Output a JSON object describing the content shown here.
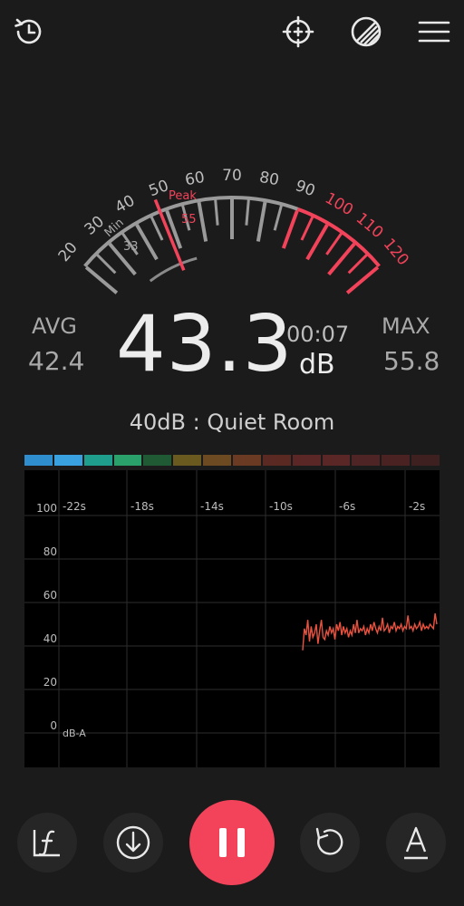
{
  "toolbar": {
    "history_icon": "history-icon",
    "calibrate_icon": "crosshair-icon",
    "theme_icon": "theme-icon",
    "menu_icon": "menu-icon"
  },
  "gauge": {
    "scale_labels": [
      "20",
      "30",
      "40",
      "50",
      "60",
      "70",
      "80",
      "90",
      "100",
      "110",
      "120"
    ],
    "min_label": "Min",
    "min_value": "33",
    "peak_label": "Peak",
    "peak_value": "55",
    "needle_value": 48,
    "normal_color": "#9a9a9a",
    "danger_color": "#f2435a"
  },
  "readout": {
    "avg_label": "AVG",
    "avg_value": "42.4",
    "current_value": "43.3",
    "elapsed": "00:07",
    "unit": "dB",
    "max_label": "MAX",
    "max_value": "55.8"
  },
  "reference_text": "40dB : Quiet Room",
  "level_bar_colors": [
    "#2f8fce",
    "#3aa1e0",
    "#1f9e8e",
    "#2aa06a",
    "#1f5a34",
    "#6a5a20",
    "#6e4a22",
    "#6a3a22",
    "#5a2a22",
    "#5a2626",
    "#5a2626",
    "#4e2424",
    "#4a2222",
    "#3e2020"
  ],
  "chart": {
    "x_tick_labels": [
      "-22s",
      "-18s",
      "-14s",
      "-10s",
      "-6s",
      "-2s"
    ],
    "y_tick_labels": [
      "100",
      "80",
      "60",
      "40",
      "20",
      "0"
    ],
    "unit_label": "dB-A",
    "line_color": "#e8523f",
    "series_db": [
      38,
      48,
      45,
      52,
      42,
      49,
      44,
      46,
      50,
      41,
      47,
      52,
      44,
      43,
      47,
      45,
      49,
      46,
      48,
      43,
      50,
      47,
      51,
      45,
      49,
      46,
      48,
      44,
      47,
      45,
      50,
      46,
      52,
      46,
      48,
      47,
      49,
      45,
      48,
      46,
      50,
      47,
      51,
      48,
      46,
      49,
      47,
      53,
      47,
      48,
      50,
      46,
      49,
      48,
      51,
      47,
      49,
      48,
      50,
      47,
      49,
      48,
      54,
      48,
      49,
      47,
      50,
      48,
      49,
      51,
      47,
      50,
      48,
      49,
      48,
      50,
      49,
      48,
      55,
      50
    ]
  },
  "controls": {
    "frequency_icon": "frequency-weighting-icon",
    "save_icon": "download-icon",
    "pause_icon": "pause-icon",
    "reset_icon": "reset-icon",
    "weighting_icon": "a-weighting-icon"
  }
}
